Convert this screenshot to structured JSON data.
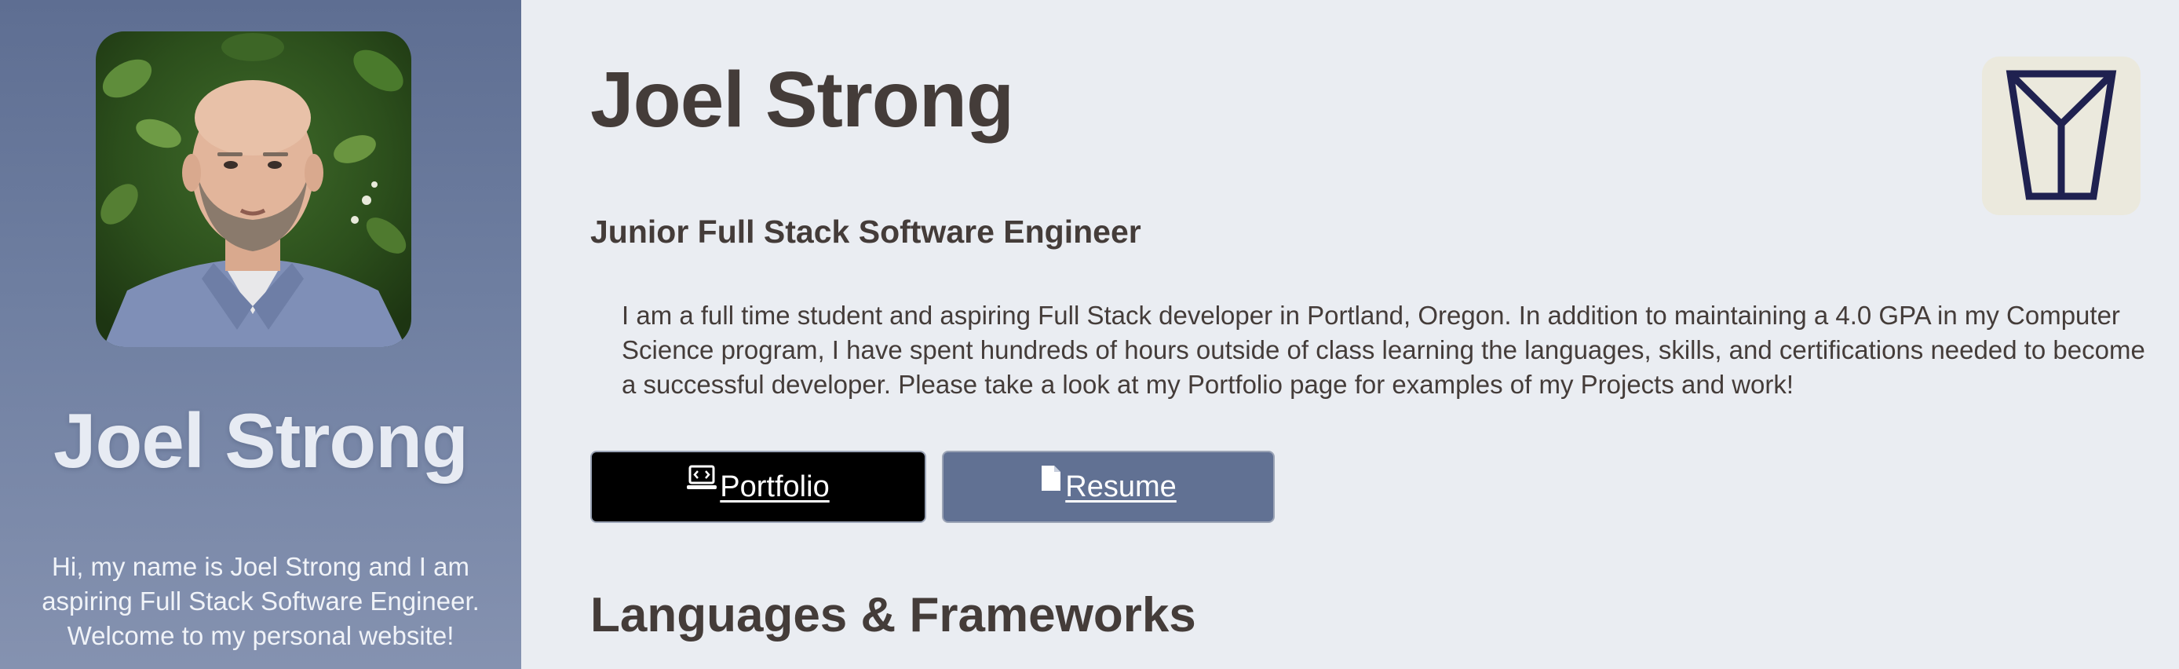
{
  "sidebar": {
    "photo_alt": "Portrait of Joel Strong",
    "name": "Joel Strong",
    "intro": "Hi, my name is Joel Strong and I am aspiring Full Stack Software Engineer. Welcome to my personal website!"
  },
  "header": {
    "name": "Joel Strong",
    "logo_icon": "monogram-logo-icon"
  },
  "main": {
    "subtitle": "Junior Full Stack Software Engineer",
    "bio": "I am a full time student and aspiring Full Stack developer in Portland, Oregon. In addition to maintaining a 4.0 GPA in my Computer Science program, I have spent hundreds of hours outside of class learning the languages, skills, and certifications needed to become a successful developer. Please take a look at my Portfolio page for examples of my Projects and work!",
    "buttons": {
      "portfolio": {
        "label": "Portfolio",
        "icon": "laptop-code-icon"
      },
      "resume": {
        "label": "Resume",
        "icon": "file-icon"
      }
    },
    "section_title": "Languages & Frameworks"
  },
  "colors": {
    "sidebar_bg": "#6a7a9c",
    "page_bg": "#eaedf2",
    "text": "#443c39",
    "resume_button": "#617193",
    "portfolio_button": "#000000",
    "logo_tile": "#ebe9dd",
    "logo_stroke": "#1f2150"
  }
}
